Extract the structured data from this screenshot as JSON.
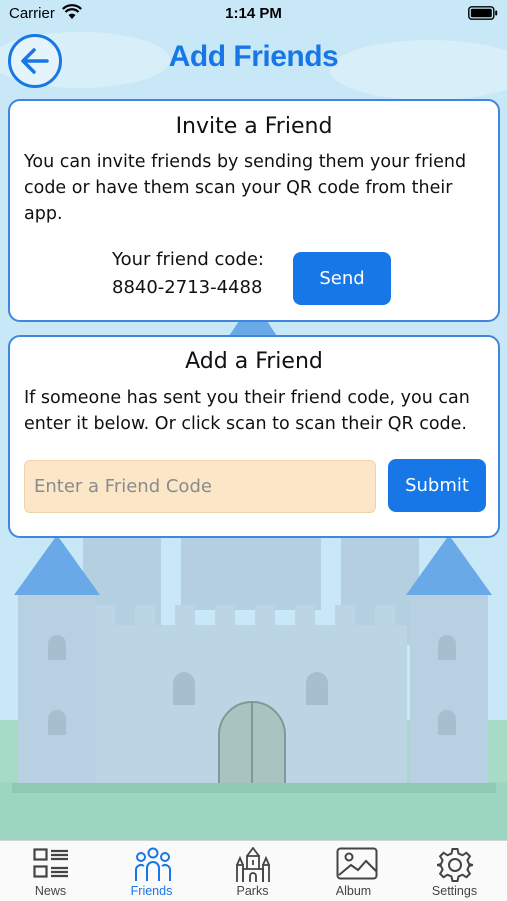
{
  "status_bar": {
    "carrier": "Carrier",
    "time": "1:14 PM"
  },
  "header": {
    "title": "Add Friends"
  },
  "invite_card": {
    "title": "Invite a Friend",
    "description": "You can invite friends by sending them your friend code or have them scan your QR code from their app.",
    "code_label": "Your friend code:",
    "code_value": "8840-2713-4488",
    "send_label": "Send"
  },
  "add_card": {
    "title": "Add a Friend",
    "description": "If someone has sent you their friend code, you can enter it below. Or click scan to scan their QR code.",
    "input_value": "",
    "input_placeholder": "Enter a Friend Code",
    "submit_label": "Submit"
  },
  "tabs": [
    {
      "label": "News",
      "icon": "news-icon",
      "active": false
    },
    {
      "label": "Friends",
      "icon": "friends-icon",
      "active": true
    },
    {
      "label": "Parks",
      "icon": "castle-icon",
      "active": false
    },
    {
      "label": "Album",
      "icon": "photo-icon",
      "active": false
    },
    {
      "label": "Settings",
      "icon": "gear-icon",
      "active": false
    }
  ],
  "colors": {
    "accent": "#1877e6",
    "sky": "#c8e8f7",
    "castle": "#b9d3e3",
    "input_bg": "#fbe6c8"
  }
}
